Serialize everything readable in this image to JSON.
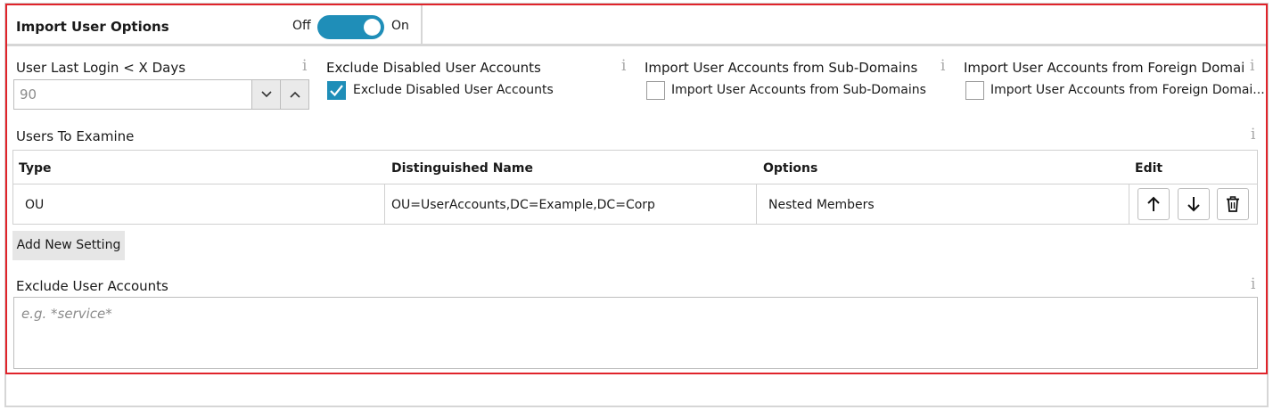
{
  "header": {
    "title": "Import User Options",
    "toggle_off_label": "Off",
    "toggle_on_label": "On",
    "toggle_state": "on"
  },
  "options": {
    "last_login": {
      "label": "User Last Login < X Days",
      "value": "90"
    },
    "exclude_disabled": {
      "label": "Exclude Disabled User Accounts",
      "checkbox_label": "Exclude Disabled User Accounts",
      "checked": true
    },
    "sub_domains": {
      "label": "Import User Accounts from Sub-Domains",
      "checkbox_label": "Import User Accounts from Sub-Domains",
      "checked": false
    },
    "foreign_domains": {
      "label": "Import User Accounts from Foreign Domains",
      "checkbox_label": "Import User Accounts from Foreign Domai...",
      "checked": false
    }
  },
  "users_to_examine": {
    "label": "Users To Examine",
    "columns": [
      "Type",
      "Distinguished Name",
      "Options",
      "Edit"
    ],
    "rows": [
      {
        "type": "OU",
        "distinguished_name": "OU=UserAccounts,DC=Example,DC=Corp",
        "options": "Nested Members"
      }
    ],
    "add_button_label": "Add New Setting"
  },
  "exclude_accounts": {
    "label": "Exclude User Accounts",
    "placeholder": "e.g. *service*"
  },
  "icons": {
    "info": "info-icon",
    "move_up": "arrow-up-icon",
    "move_down": "arrow-down-icon",
    "delete": "trash-icon",
    "spin_up": "chevron-up-icon",
    "spin_down": "chevron-down-icon",
    "check": "checkmark-icon"
  },
  "colors": {
    "accent": "#1f8eb8",
    "frame_highlight": "#e0242b",
    "info_icon": "#a8a8a8"
  }
}
